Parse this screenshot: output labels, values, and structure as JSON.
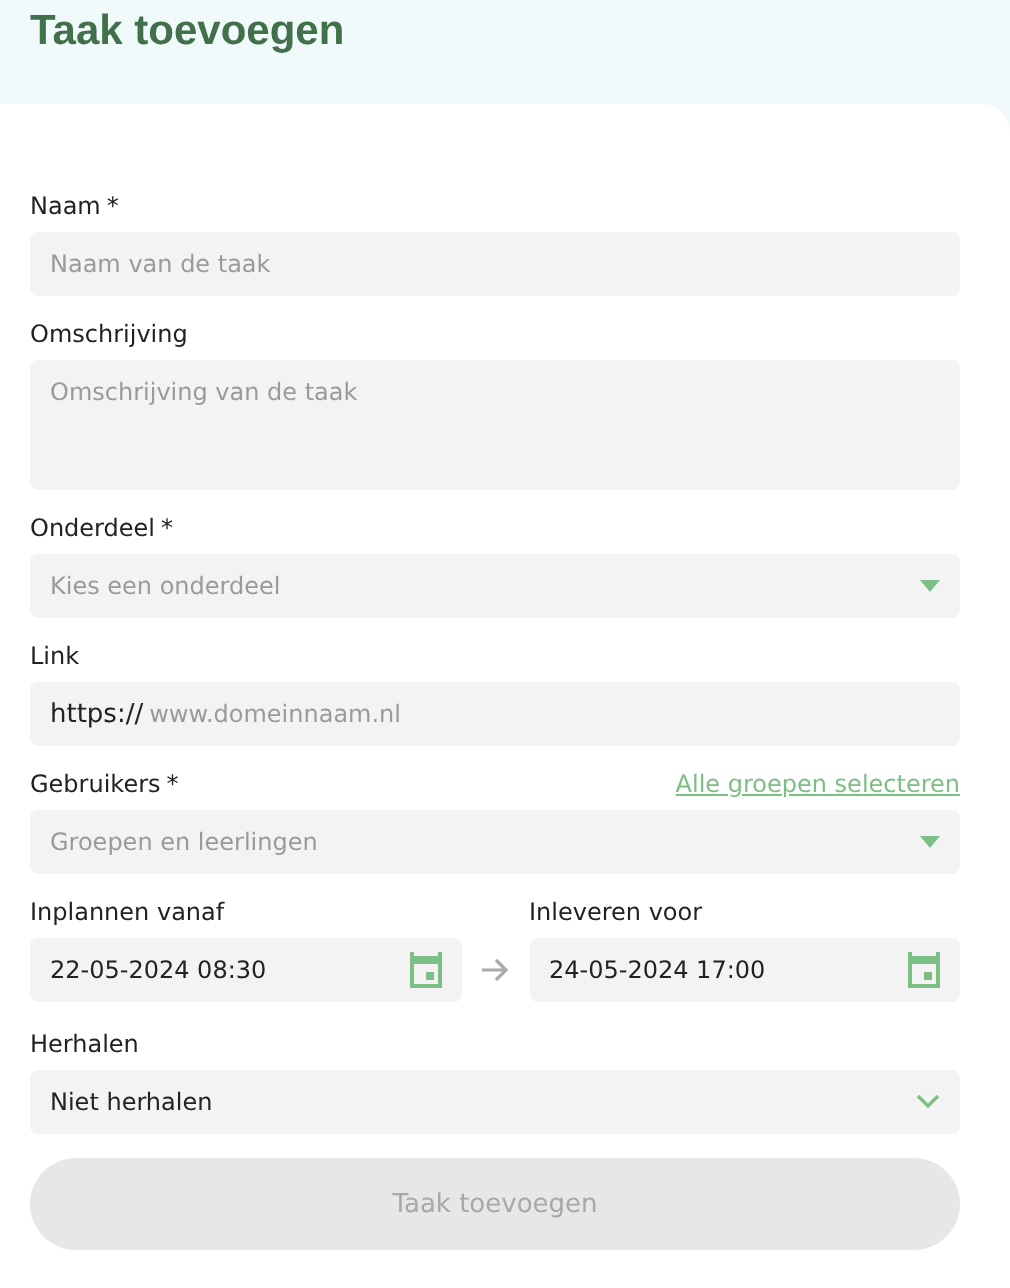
{
  "title": "Taak toevoegen",
  "fields": [
    {
      "kind": "text",
      "label": "Naam",
      "required_mark": "*",
      "placeholder": "Naam van de taak"
    },
    {
      "kind": "textarea",
      "label": "Omschrijving",
      "placeholder": "Omschrijving van de taak"
    },
    {
      "kind": "select",
      "label": "Onderdeel",
      "required_mark": "*",
      "placeholder": "Kies een onderdeel"
    },
    {
      "kind": "link",
      "label": "Link",
      "prefix": "https://",
      "placeholder": "www.domeinnaam.nl"
    },
    {
      "kind": "select",
      "label": "Gebruikers",
      "required_mark": "*",
      "placeholder": "Groepen en leerlingen",
      "action": "Alle groepen selecteren"
    },
    {
      "kind": "dates",
      "from": {
        "label": "Inplannen vanaf",
        "value": "22-05-2024 08:30"
      },
      "to": {
        "label": "Inleveren voor",
        "value": "24-05-2024 17:00"
      }
    },
    {
      "kind": "menu",
      "label": "Herhalen",
      "value": "Niet herhalen"
    }
  ],
  "submit": {
    "label": "Taak toevoegen",
    "disabled": true
  }
}
